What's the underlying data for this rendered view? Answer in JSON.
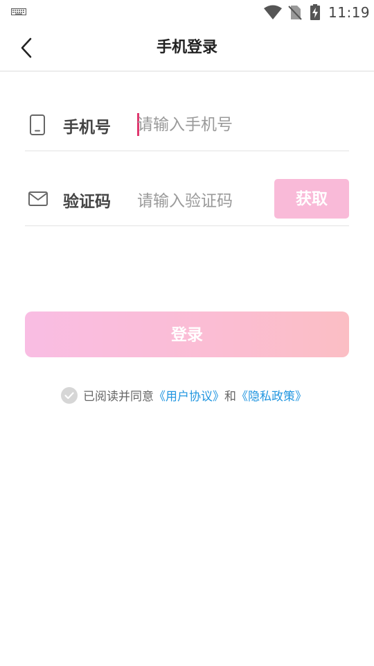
{
  "status_bar": {
    "time": "11:19",
    "icons": [
      "keyboard-icon",
      "wifi-icon",
      "no-sim-icon",
      "battery-charging-icon"
    ]
  },
  "nav": {
    "title": "手机登录",
    "back_icon": "chevron-left-icon"
  },
  "phone_row": {
    "icon": "phone-icon",
    "label": "手机号",
    "placeholder": "请输入手机号",
    "value": ""
  },
  "code_row": {
    "icon": "mail-icon",
    "label": "验证码",
    "placeholder": "请输入验证码",
    "value": "",
    "get_code_label": "获取"
  },
  "login_button": {
    "label": "登录"
  },
  "agreement": {
    "checked_icon": "check-circle-icon",
    "prefix": "已阅读并同意",
    "user_agreement": "《用户协议》",
    "joiner": "和",
    "privacy_policy": "《隐私政策》"
  },
  "colors": {
    "accent_pink": "#f9bad8",
    "link_blue": "#2196e0",
    "caret": "#e0386f"
  }
}
